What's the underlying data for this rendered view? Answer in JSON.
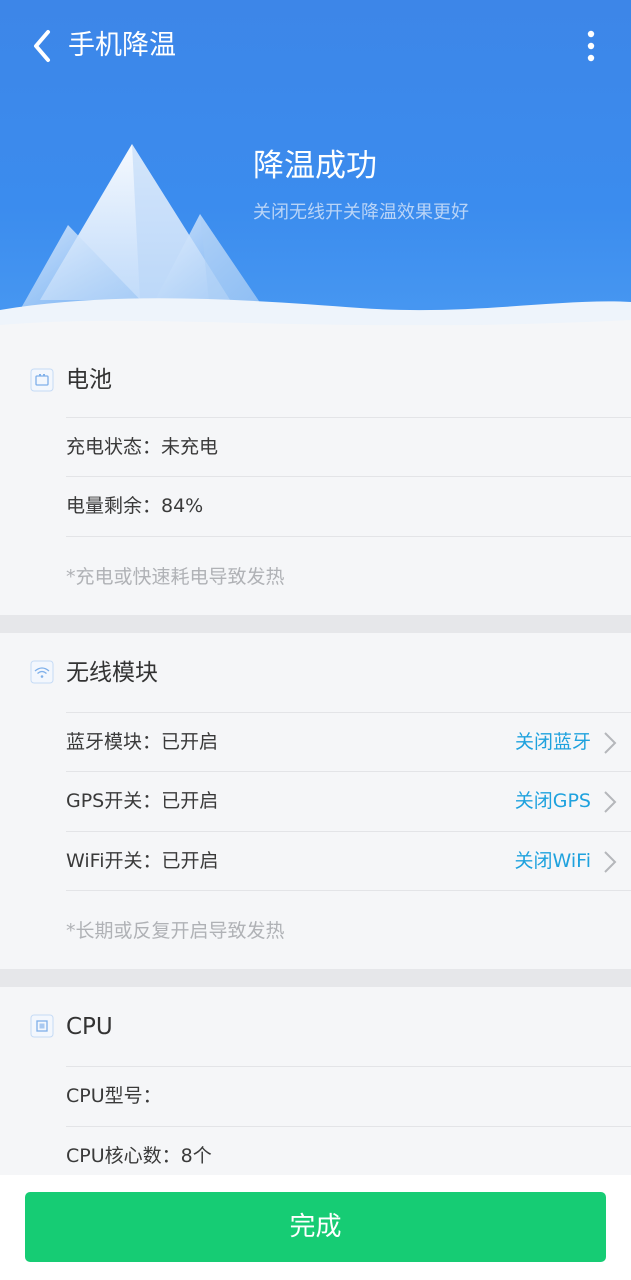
{
  "nav": {
    "title": "手机降温"
  },
  "hero": {
    "title": "降温成功",
    "subtitle": "关闭无线开关降温效果更好"
  },
  "battery": {
    "title": "电池",
    "rows": [
      "充电状态：未充电",
      "电量剩余：84%"
    ],
    "note": "*充电或快速耗电导致发热"
  },
  "wireless": {
    "title": "无线模块",
    "rows": [
      {
        "text": "蓝牙模块：已开启",
        "action": "关闭蓝牙"
      },
      {
        "text": "GPS开关：已开启",
        "action": "关闭GPS"
      },
      {
        "text": "WiFi开关：已开启",
        "action": "关闭WiFi"
      }
    ],
    "note": "*长期或反复开启导致发热"
  },
  "cpu": {
    "title": "CPU",
    "rows": [
      "CPU型号：",
      "CPU核心数：8个"
    ]
  },
  "footer": {
    "done_label": "完成"
  },
  "colors": {
    "header_blue": "#3d86e8",
    "accent_green": "#16cc74",
    "link_blue": "#1fa2de"
  }
}
